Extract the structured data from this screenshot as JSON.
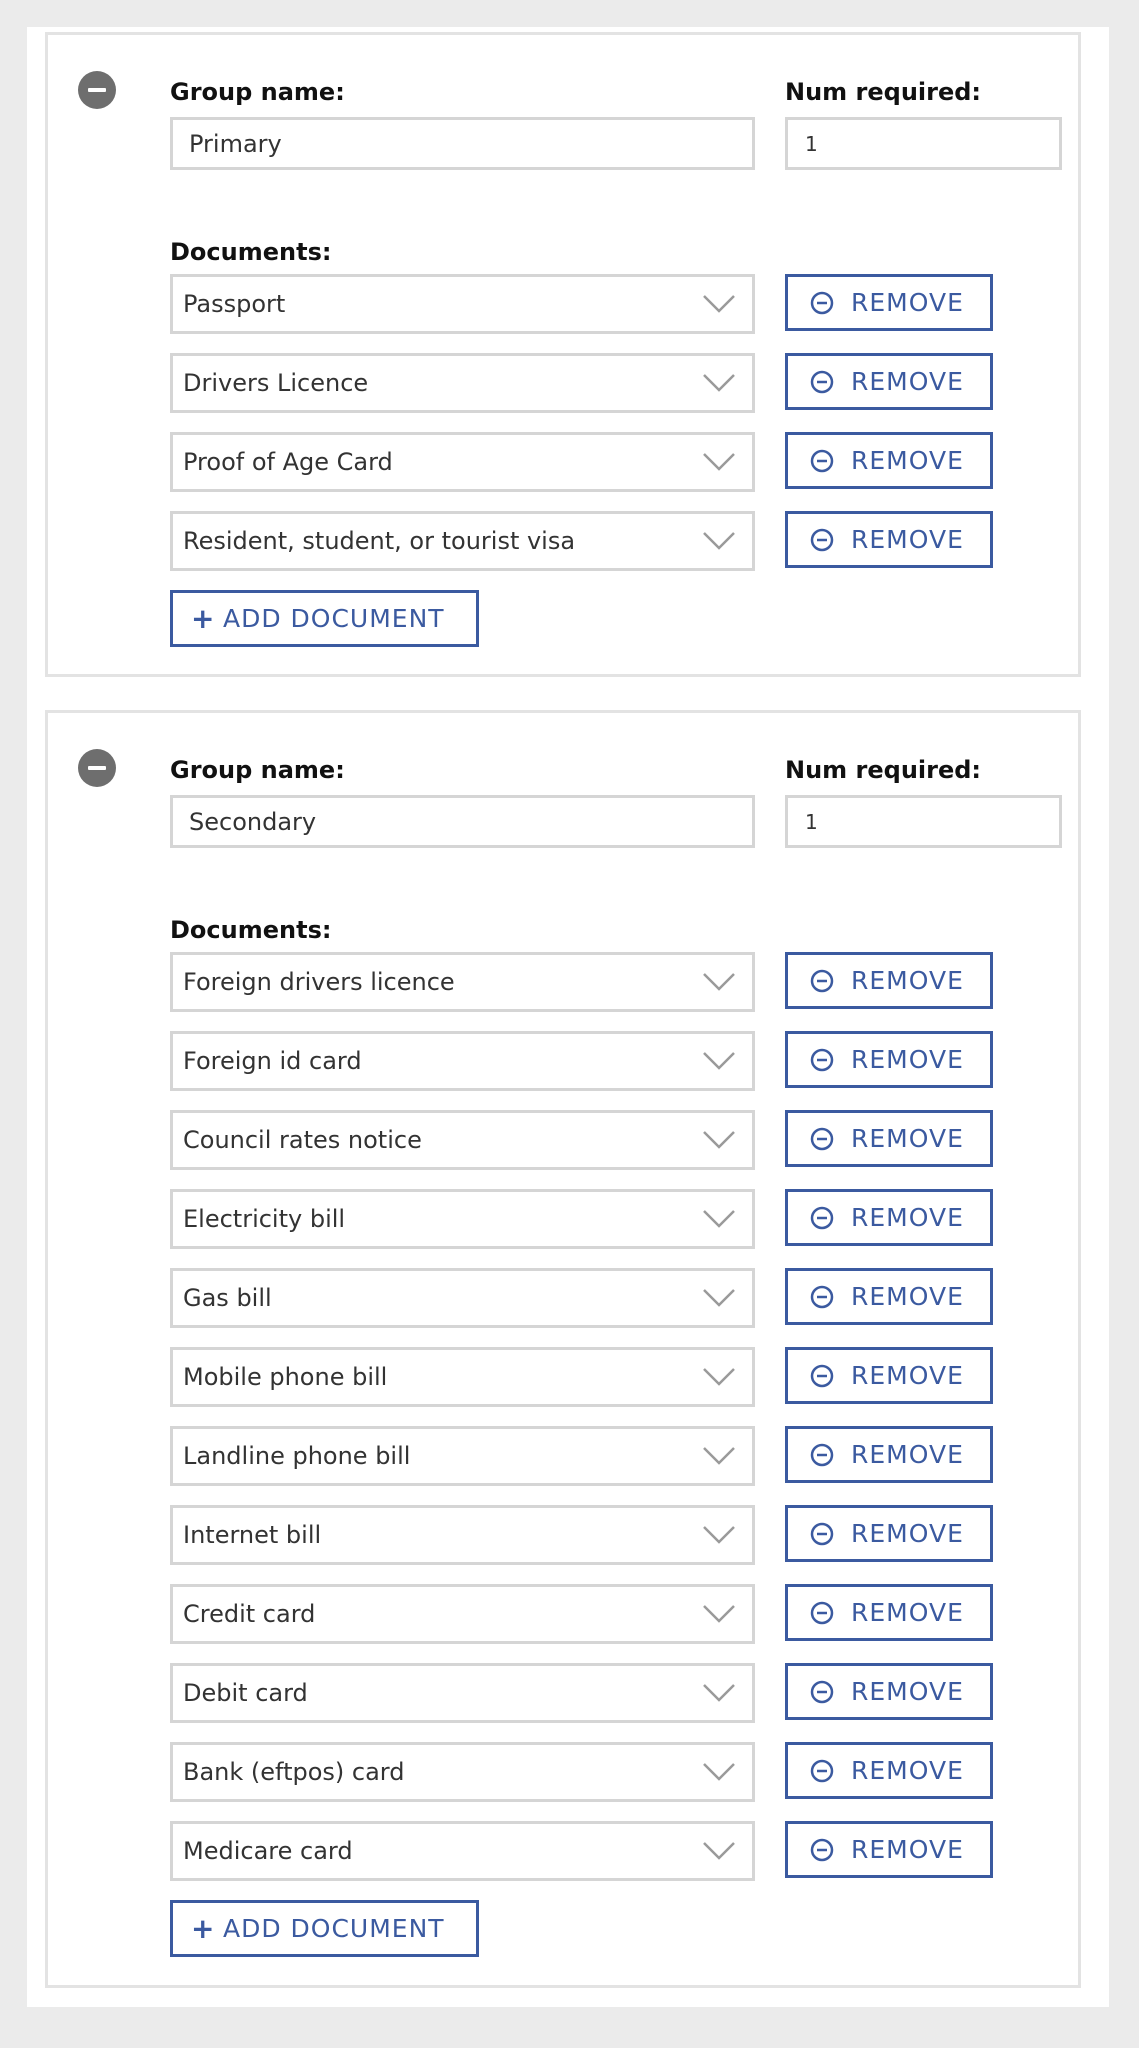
{
  "labels": {
    "group_name": "Group name:",
    "num_required": "Num required:",
    "documents": "Documents:",
    "remove": "REMOVE",
    "add_document": "ADD DOCUMENT",
    "add_plus": "+"
  },
  "colors": {
    "accent": "#3b5aa0",
    "border": "#d5d5d5",
    "group_remove": "#6e6e6e",
    "background": "#ebebeb"
  },
  "icons": {
    "group_remove": "minus-circle-icon",
    "dropdown": "chevron-down-icon",
    "remove": "minus-circle-outline-icon",
    "add": "plus-icon"
  },
  "groups": [
    {
      "name": "Primary",
      "num_required": "1",
      "documents": [
        "Passport",
        "Drivers Licence",
        "Proof of Age Card",
        "Resident, student, or tourist visa"
      ]
    },
    {
      "name": "Secondary",
      "num_required": "1",
      "documents": [
        "Foreign drivers licence",
        "Foreign id card",
        "Council rates notice",
        "Electricity bill",
        "Gas bill",
        "Mobile phone bill",
        "Landline phone bill",
        "Internet bill",
        "Credit card",
        "Debit card",
        "Bank (eftpos) card",
        "Medicare card"
      ]
    }
  ]
}
